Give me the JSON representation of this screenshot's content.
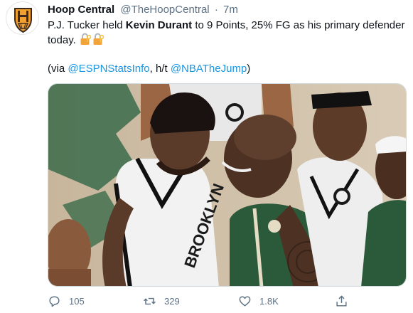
{
  "tweet": {
    "display_name": "Hoop Central",
    "handle": "@TheHoopCentral",
    "separator": "·",
    "time": "7m",
    "text_before": "P.J. Tucker held ",
    "text_bold": "Kevin Durant",
    "text_after": " to 9 Points, 25% FG as his primary defender today. ",
    "via_prefix": "(via ",
    "via_link1": "@ESPNStatsInfo",
    "via_middle": ", h/t ",
    "via_link2": "@NBATheJump",
    "via_suffix": ")",
    "jersey_text_1": "BROOKLYN",
    "jersey_text_2": "BROOKLYN"
  },
  "actions": {
    "reply_count": "105",
    "retweet_count": "329",
    "like_count": "1.8K"
  },
  "icons": {
    "avatar": "hoop-central-logo",
    "emoji": "locked-with-key-icon",
    "reply": "reply-icon",
    "retweet": "retweet-icon",
    "like": "heart-icon",
    "share": "share-icon"
  },
  "colors": {
    "accent_link": "#1b95e0",
    "secondary_text": "#5b7083",
    "brand_gold": "#f0a030",
    "brand_dark": "#3d2b1f"
  }
}
